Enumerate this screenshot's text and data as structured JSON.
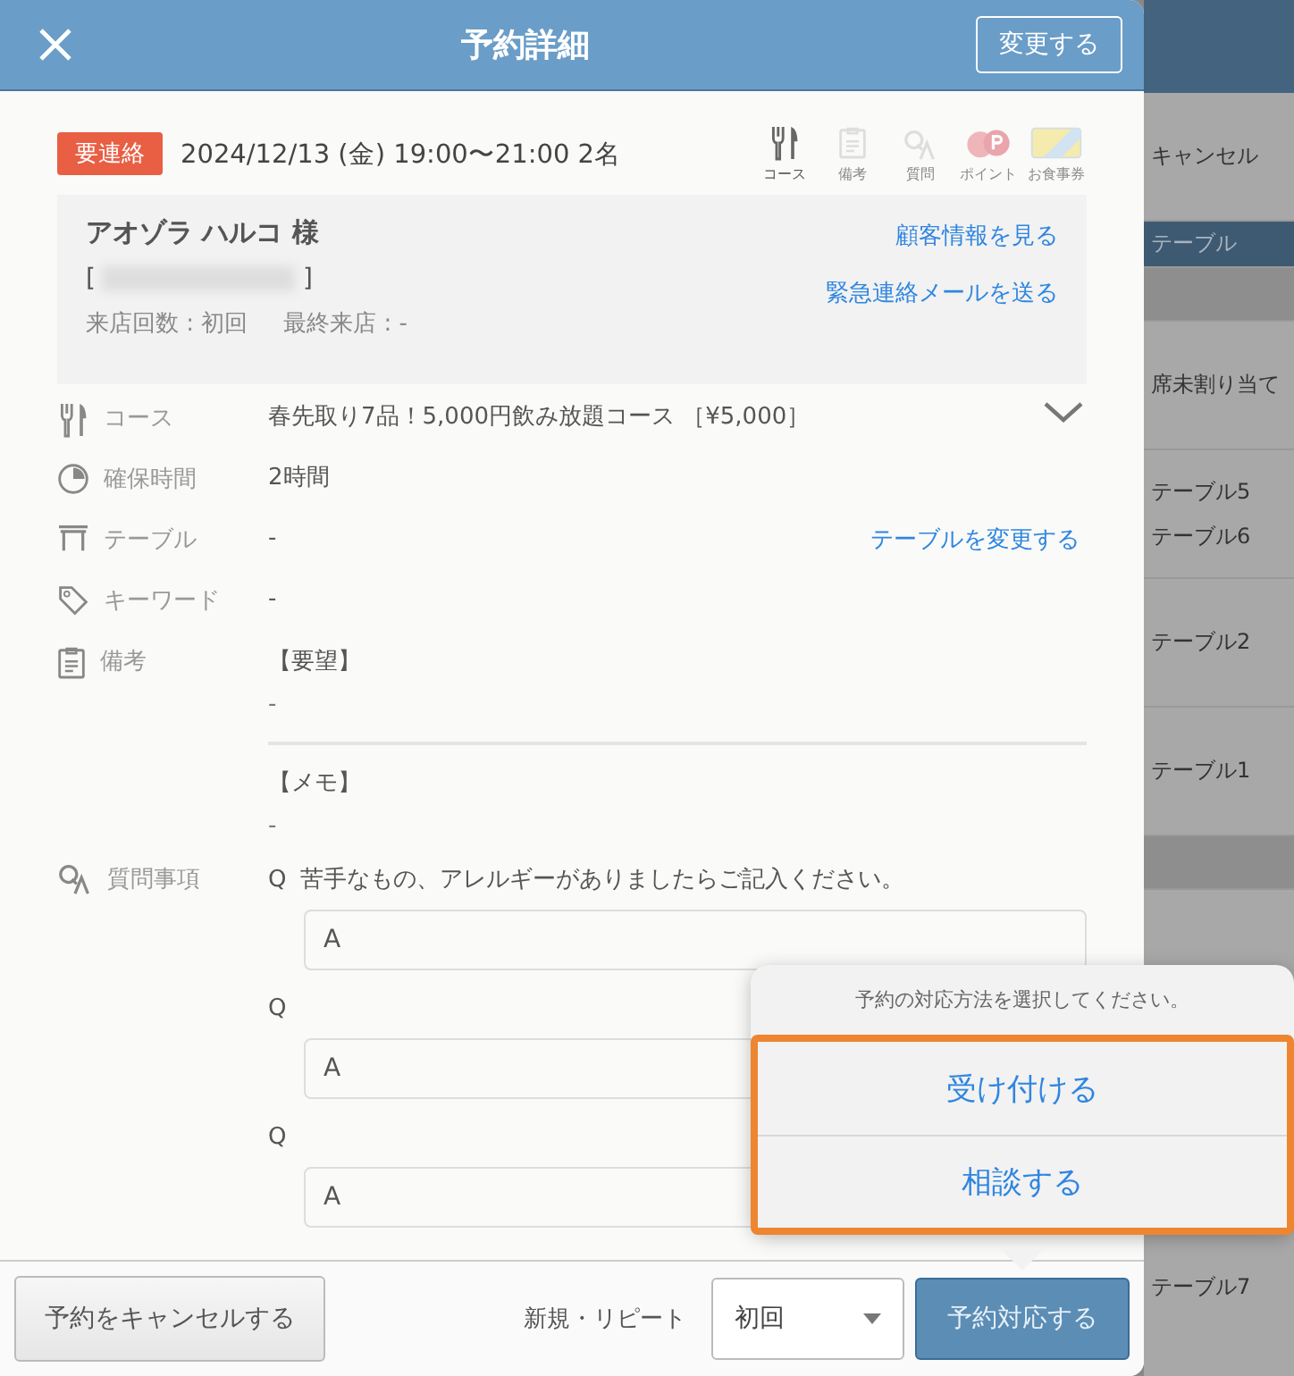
{
  "header": {
    "title": "予約詳細",
    "edit_button": "変更する"
  },
  "summary": {
    "status_badge": "要連絡",
    "datetime": "2024/12/13 (金) 19:00〜21:00 2名",
    "features": [
      {
        "kind": "course",
        "label": "コース",
        "active": true
      },
      {
        "kind": "memo",
        "label": "備考",
        "active": false
      },
      {
        "kind": "question",
        "label": "質問",
        "active": false
      },
      {
        "kind": "point",
        "label": "ポイント",
        "active": false
      },
      {
        "kind": "voucher",
        "label": "お食事券",
        "active": false
      }
    ]
  },
  "customer": {
    "name": "アオゾラ ハルコ 様",
    "phone": {
      "open": "[",
      "close": "]"
    },
    "visits": "来店回数 : 初回",
    "last_visit": "最終来店 : -",
    "links": [
      "顧客情報を見る",
      "緊急連絡メールを送る"
    ]
  },
  "details": [
    {
      "kind": "course",
      "label": "コース",
      "value": "春先取り7品！5,000円飲み放題コース ［¥5,000］",
      "expandable": true
    },
    {
      "kind": "time",
      "label": "確保時間",
      "value": "2時間"
    },
    {
      "kind": "table",
      "label": "テーブル",
      "value": "-",
      "link": "テーブルを変更する"
    },
    {
      "kind": "keyword",
      "label": "キーワード",
      "value": "-"
    },
    {
      "kind": "notes",
      "label": "備考",
      "sections": [
        {
          "heading": "【要望】",
          "text": "-"
        },
        {
          "heading": "【メモ】",
          "text": "-"
        }
      ]
    },
    {
      "kind": "questions",
      "label": "質問事項",
      "items": [
        {
          "prefix": "Q",
          "text": "苦手なもの、アレルギーがありましたらご記入ください。",
          "answer": "A"
        },
        {
          "prefix": "Q",
          "answer": "A"
        },
        {
          "prefix": "Q",
          "answer": "A"
        }
      ]
    }
  ],
  "footer": {
    "cancel_button": "予約をキャンセルする",
    "type_label": "新規・リピート",
    "type_select": "初回",
    "respond_button": "予約対応する"
  },
  "popover": {
    "title": "予約の対応方法を選択してください。",
    "highlighted": true,
    "options": [
      {
        "label": "受け付ける"
      },
      {
        "label": "相談する"
      }
    ]
  },
  "background_list": [
    {
      "kind": "row",
      "texts": [
        "キャンセル"
      ]
    },
    {
      "kind": "header",
      "texts": [
        "テーブル"
      ]
    },
    {
      "kind": "section"
    },
    {
      "kind": "row",
      "texts": [
        "席未割り当て"
      ]
    },
    {
      "kind": "row",
      "texts": [
        "テーブル5",
        "テーブル6"
      ]
    },
    {
      "kind": "row",
      "texts": [
        "テーブル2"
      ]
    },
    {
      "kind": "row",
      "texts": [
        "テーブル1"
      ]
    },
    {
      "kind": "section"
    },
    {
      "kind": "bottom",
      "texts": [
        "テーブル7"
      ]
    }
  ]
}
